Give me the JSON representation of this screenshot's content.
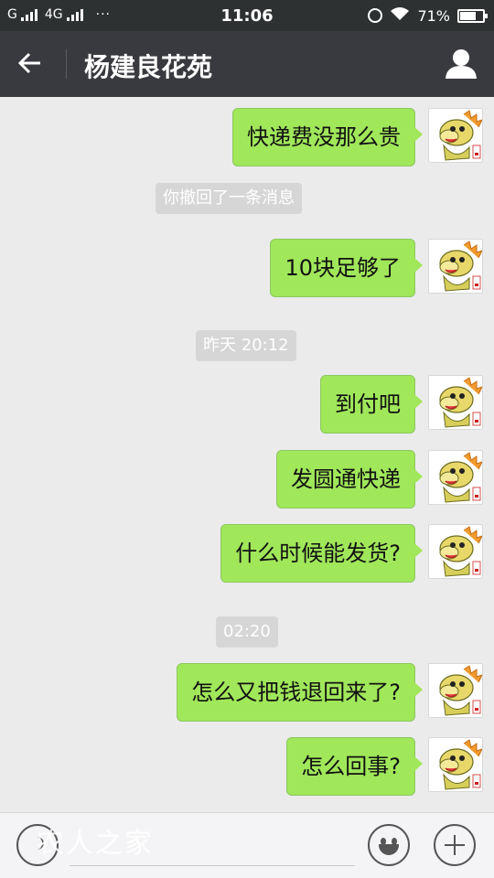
{
  "status_bar": {
    "carrier": "G",
    "network": "4G",
    "more": "···",
    "time": "11:06",
    "battery_percent": "71%",
    "battery_level": 0.71
  },
  "header": {
    "title": "杨建良花苑"
  },
  "messages": [
    {
      "type": "sent",
      "text": "快递费没那么贵"
    },
    {
      "type": "system",
      "text": "你撤回了一条消息"
    },
    {
      "type": "sent",
      "text": "10块足够了"
    },
    {
      "type": "time",
      "text": "昨天 20:12"
    },
    {
      "type": "sent",
      "text": "到付吧"
    },
    {
      "type": "sent",
      "text": "发圆通快递"
    },
    {
      "type": "sent",
      "text": "什么时候能发货?"
    },
    {
      "type": "time",
      "text": "02:20"
    },
    {
      "type": "sent",
      "text": "怎么又把钱退回来了?"
    },
    {
      "type": "sent",
      "text": "怎么回事?"
    }
  ],
  "input_bar": {
    "watermark": "农人之家",
    "placeholder": ""
  },
  "colors": {
    "bubble": "#a0e75a",
    "header": "#393a3f",
    "status": "#2e3132",
    "background": "#ebebeb"
  }
}
